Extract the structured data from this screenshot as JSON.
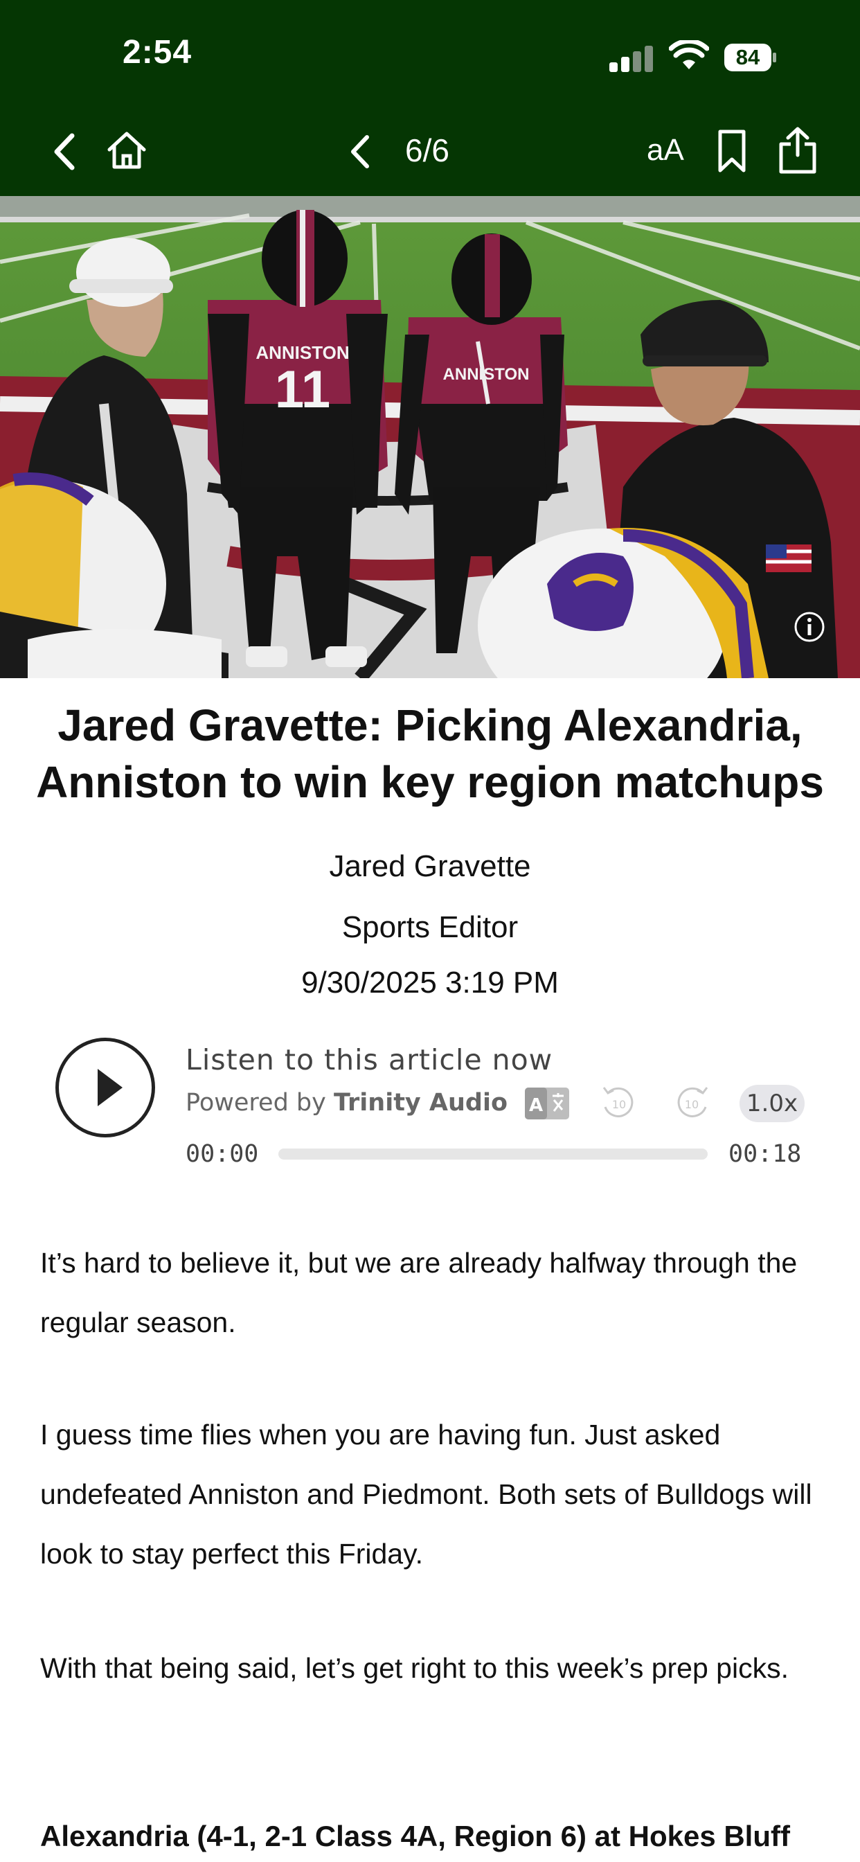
{
  "status_bar": {
    "time": "2:54",
    "battery": "84"
  },
  "nav": {
    "back_icon": "chevron-left-icon",
    "home_icon": "home-icon",
    "prev_icon": "chevron-left-icon",
    "pager": "6/6",
    "font_size_label": "aA",
    "bookmark_icon": "bookmark-icon",
    "share_icon": "share-icon"
  },
  "colors": {
    "header_bg": "#053603",
    "jersey_maroon": "#8a2245",
    "helmet_purple": "#4a2a8c",
    "helmet_gold": "#e8b51a"
  },
  "hero": {
    "jersey_left": "ANNISTON",
    "jersey_left_number": "11",
    "jersey_right": "ANNISTON",
    "info_icon": "info-icon"
  },
  "article": {
    "headline": "Jared Gravette: Picking Alexandria, Anniston to win key region matchups",
    "author": "Jared Gravette",
    "role": "Sports Editor",
    "date": "9/30/2025 3:19 PM",
    "paragraphs": [
      "It’s hard to believe it, but we are already halfway through the regular season.",
      "I guess time flies when you are having fun. Just asked undefeated Anniston and Piedmont. Both sets of Bulldogs will look to stay perfect this Friday.",
      "With that being said, let’s get right to this week’s prep picks."
    ],
    "subhead": "Alexandria (4-1, 2-1 Class 4A, Region 6) at Hokes Bluff"
  },
  "audio": {
    "title": "Listen to this article now",
    "powered_by": "Powered by",
    "brand": "Trinity Audio",
    "rewind_label": "10",
    "forward_label": "10",
    "speed": "1.0x",
    "current_time": "00:00",
    "duration": "00:18",
    "progress": 0
  }
}
